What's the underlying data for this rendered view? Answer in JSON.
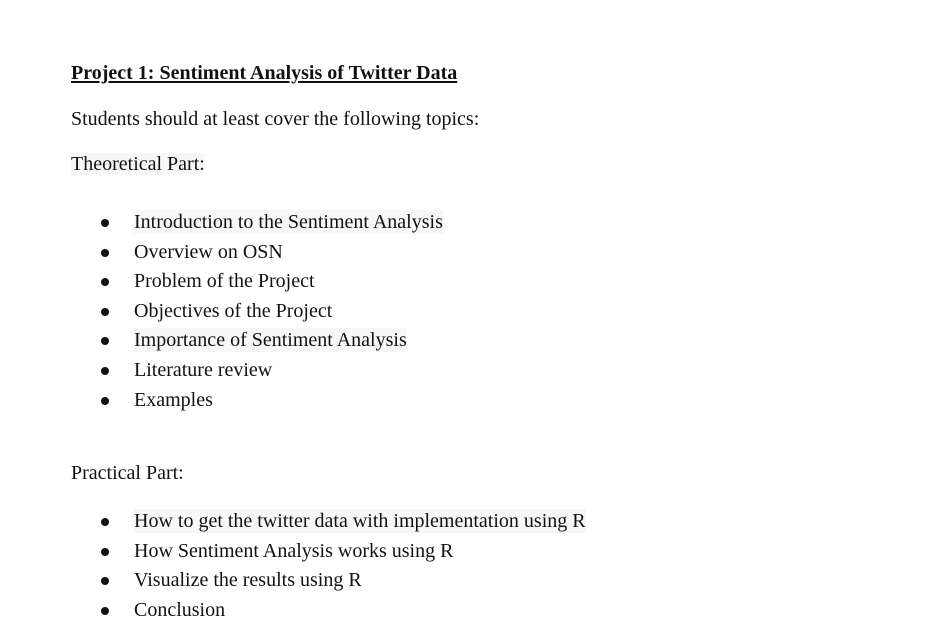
{
  "document": {
    "title": "Project 1: Sentiment Analysis of Twitter Data",
    "intro": "Students should at least cover the following topics:",
    "theoretical": {
      "heading": "Theoretical Part:",
      "items": [
        {
          "label": "Introduction to the Sentiment Analysis"
        },
        {
          "label": "Overview on OSN"
        },
        {
          "label": "Problem of the Project"
        },
        {
          "label": "Objectives of the Project"
        },
        {
          "label": "Importance of Sentiment Analysis"
        },
        {
          "label": "Literature review"
        },
        {
          "label": "Examples"
        }
      ]
    },
    "practical": {
      "heading": "Practical Part:",
      "items": [
        {
          "label": "How to get the twitter data with implementation using R"
        },
        {
          "label": "How Sentiment Analysis works using R"
        },
        {
          "label": "Visualize the results using R"
        },
        {
          "label": "Conclusion"
        }
      ]
    }
  }
}
